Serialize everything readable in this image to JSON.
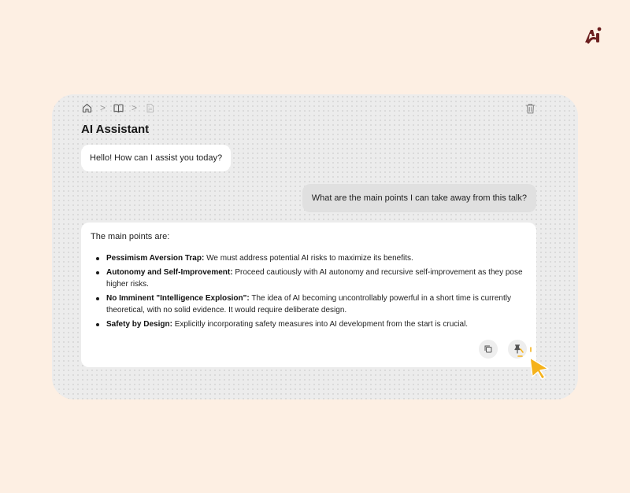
{
  "brand": {
    "logo_icon": "ai-logo-icon",
    "color": "#6b1f1f"
  },
  "breadcrumb": {
    "items": [
      {
        "icon": "home-icon"
      },
      {
        "icon": "book-icon"
      },
      {
        "icon": "document-icon"
      }
    ],
    "separator": ">"
  },
  "header": {
    "title": "AI Assistant",
    "delete_icon": "trash-icon"
  },
  "chat": {
    "assistant_greeting": "Hello! How can I assist you today?",
    "user_message": "What are the main points I can take away from this talk?",
    "answer": {
      "intro": "The main points are:",
      "points": [
        {
          "heading": "Pessimism Aversion Trap:",
          "text": " We must address potential AI risks to maximize its benefits."
        },
        {
          "heading": "Autonomy and Self-Improvement:",
          "text": " Proceed cautiously with AI autonomy and recursive self-improvement as they pose higher risks."
        },
        {
          "heading": "No Imminent \"Intelligence Explosion\":",
          "text": " The idea of AI becoming uncontrollably powerful in a short time is currently theoretical, with no solid evidence. It would require deliberate design."
        },
        {
          "heading": "Safety by Design:",
          "text": " Explicitly incorporating safety measures into AI development from the start is crucial."
        }
      ]
    },
    "actions": {
      "copy_icon": "copy-icon",
      "pin_icon": "pin-icon"
    }
  },
  "colors": {
    "accent_cursor": "#f5b21b",
    "background": "#fdefe3"
  }
}
